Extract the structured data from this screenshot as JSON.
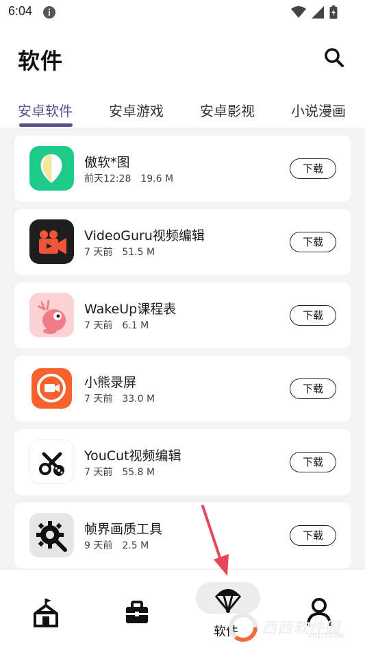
{
  "status_bar": {
    "time": "6:04"
  },
  "header": {
    "title": "软件"
  },
  "tabs": [
    {
      "label": "安卓软件",
      "active": true
    },
    {
      "label": "安卓游戏",
      "active": false
    },
    {
      "label": "安卓影视",
      "active": false
    },
    {
      "label": "小说漫画",
      "active": false
    }
  ],
  "apps": [
    {
      "name": "傲软*图",
      "date": "前天12:28",
      "size": "19.6 M",
      "button": "下载",
      "icon": "aoruan-app-icon"
    },
    {
      "name": "VideoGuru视频编辑",
      "date": "7 天前",
      "size": "51.5 M",
      "button": "下载",
      "icon": "videoguru-app-icon"
    },
    {
      "name": "WakeUp课程表",
      "date": "7 天前",
      "size": "6.1 M",
      "button": "下载",
      "icon": "wakeup-app-icon"
    },
    {
      "name": "小熊录屏",
      "date": "7 天前",
      "size": "33.0 M",
      "button": "下载",
      "icon": "xiaoxiong-app-icon"
    },
    {
      "name": "YouCut视频编辑",
      "date": "7 天前",
      "size": "55.8 M",
      "button": "下载",
      "icon": "youcut-app-icon"
    },
    {
      "name": "帧界画质工具",
      "date": "9 天前",
      "size": "2.5 M",
      "button": "下载",
      "icon": "zhenjie-app-icon"
    }
  ],
  "bottom_nav": {
    "active_label": "软件",
    "items": [
      "home-icon",
      "toolbox-icon",
      "parachute-icon",
      "profile-icon"
    ]
  },
  "watermark": {
    "text": "西西软件园",
    "sub": "CR173.COM"
  },
  "colors": {
    "accent": "#5c4a8e",
    "list_background": "#f3f3f3",
    "arrow": "#e8475a"
  }
}
